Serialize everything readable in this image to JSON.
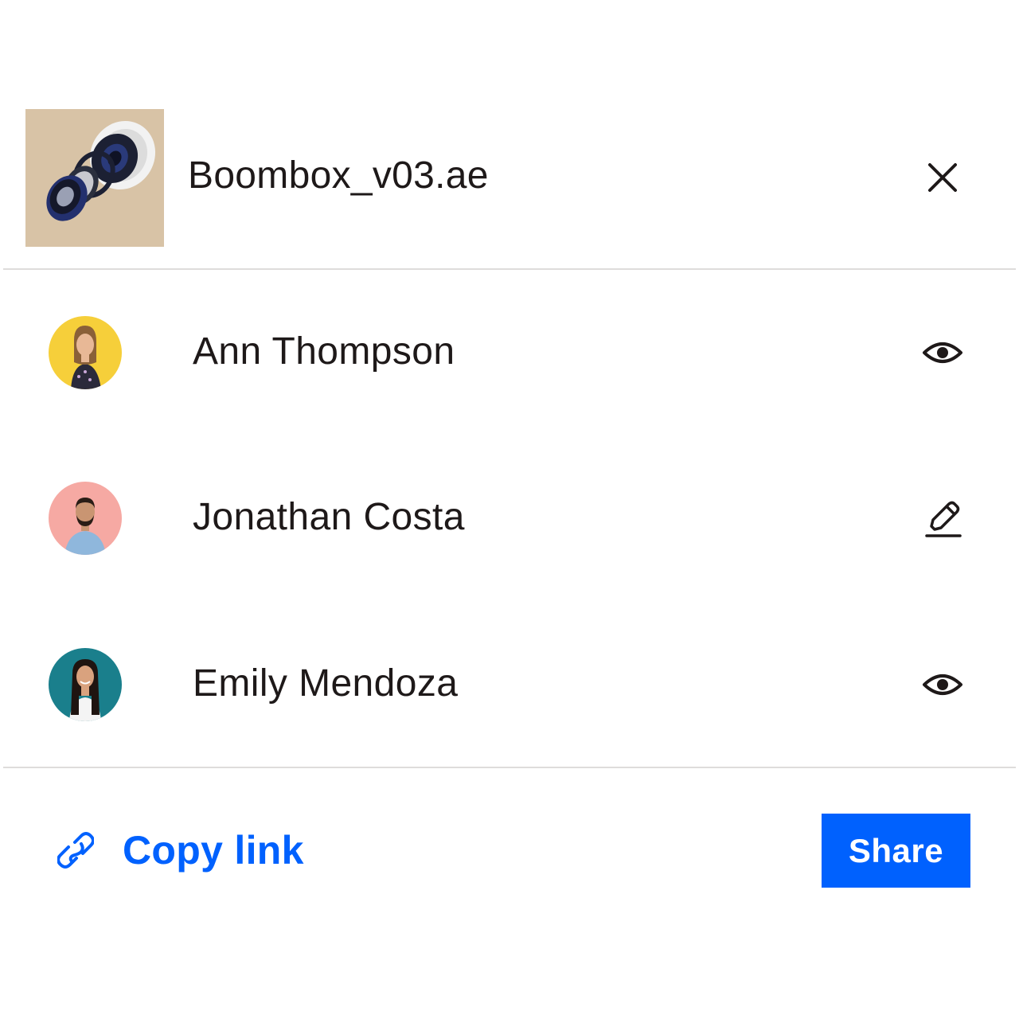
{
  "file": {
    "name": "Boombox_v03.ae",
    "thumbnail_icon": "speaker-thumbnail",
    "thumbnail_bg": "#d8c3a6"
  },
  "members": [
    {
      "name": "Ann Thompson",
      "avatar_bg": "#f6cf3a",
      "permission_icon": "eye-icon"
    },
    {
      "name": "Jonathan Costa",
      "avatar_bg": "#f6a9a3",
      "permission_icon": "pencil-icon"
    },
    {
      "name": "Emily Mendoza",
      "avatar_bg": "#1a7f8c",
      "permission_icon": "eye-icon"
    }
  ],
  "footer": {
    "copy_link_label": "Copy link",
    "copy_link_icon": "link-icon",
    "share_label": "Share"
  },
  "colors": {
    "accent": "#0061fe",
    "text": "#1e1919",
    "divider": "#dedcdb"
  }
}
